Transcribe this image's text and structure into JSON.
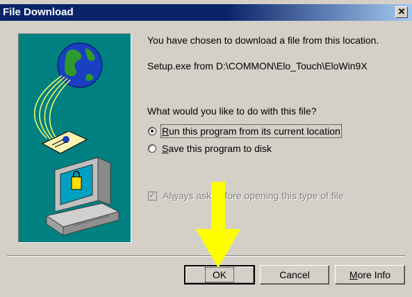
{
  "window": {
    "title": "File Download"
  },
  "message": {
    "line1": "You have chosen to download a file from this location.",
    "line2": "Setup.exe from D:\\COMMON\\Elo_Touch\\EloWin9X",
    "question": "What would you like to do with this file?"
  },
  "options": {
    "run": {
      "accel": "R",
      "rest": "un this program from its current location",
      "checked": true
    },
    "save": {
      "accel": "S",
      "rest": "ave this program to disk",
      "checked": false
    }
  },
  "always_ask": {
    "pre": "Al",
    "accel": "w",
    "post": "ays ask before opening this type of file",
    "checked": true,
    "disabled": true
  },
  "buttons": {
    "ok": "OK",
    "cancel": "Cancel",
    "more_info_accel": "M",
    "more_info_rest": "ore Info"
  },
  "colors": {
    "title_bar": "#0a246a",
    "illustration_bg": "#008080",
    "arrow": "#ffff00"
  }
}
